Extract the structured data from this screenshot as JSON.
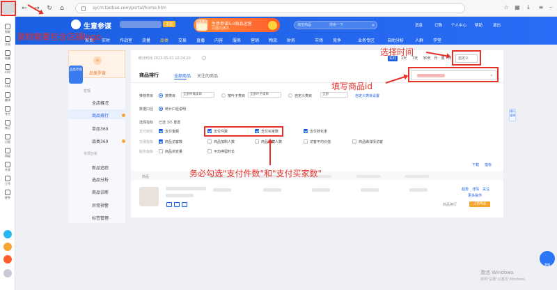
{
  "browser": {
    "url": "sycm.taobao.com/portal/home.htm",
    "nav_back": "←",
    "nav_forward": "→",
    "nav_reload": "↻",
    "nav_home": "⌂"
  },
  "sidebar": {
    "items": [
      "智能",
      "文档",
      "收藏",
      "AI写",
      "AI读",
      "翻译",
      "专栏",
      "笔记",
      "日程",
      "网盘",
      "共享",
      "工作",
      "更多"
    ]
  },
  "header": {
    "title": "生意参谋",
    "badge": "主店",
    "promo_tag": "抢先看",
    "promo_title": "生意参谋5.0商品运营",
    "promo_sub": "兴趣内测中",
    "search_label": "淘宝商品",
    "search_placeholder": "搜索一下",
    "right_links": [
      "消息",
      "订购",
      "个人中心",
      "帮助",
      "退出"
    ],
    "nav": [
      "首页",
      "实时",
      "作战室",
      "流量",
      "品类",
      "交易",
      "直播",
      "内容",
      "服务",
      "营销",
      "物流",
      "财务",
      "市场",
      "竞争",
      "业务专区",
      "自助分析",
      "人群",
      "学堂"
    ],
    "nav_active_index": 4
  },
  "left_menu": {
    "top_label": "品类罗盘",
    "float_label": "品类罗盘",
    "group1": "宏观",
    "group2": "商品",
    "group3": "专项分析",
    "items": [
      "全店概况",
      "商品排行",
      "单品360",
      "品类360",
      "新品追踪",
      "选品分析",
      "商品诊断",
      "异常预警",
      "标签管理"
    ],
    "active_index": 1
  },
  "toolbar": {
    "stats_time": "统计时间 2023-05-01 10:24:20",
    "segments": [
      "实时",
      "1天",
      "7天",
      "30天",
      "日",
      "周",
      "月"
    ],
    "date_picker": "自定义"
  },
  "card": {
    "title": "商品排行",
    "tab_all": "全部商品",
    "tab_fav": "关注的商品",
    "search_icon": "⌕"
  },
  "filters": {
    "row1_label": "推荐类目",
    "row1_opt1": "按类目",
    "row1_sel1": "全部终端类目",
    "row1_opt2": "按叶子类目",
    "row1_sel2": "全部叶子类目",
    "row1_opt3": "自定义类目",
    "row1_sel3": "全部",
    "row1_link": "自定义类目设置",
    "row2_label": "数据口径",
    "row2_opt": "统计口径说明",
    "row3_label": "选择指标",
    "row3_count": "已选 3/5 重置",
    "metric_groups": [
      "支付转化",
      "交易指标",
      "服务指标",
      "流量指标"
    ],
    "metrics": [
      {
        "label": "支付金额",
        "checked": true
      },
      {
        "label": "支付件数",
        "checked": true
      },
      {
        "label": "支付买家数",
        "checked": true
      },
      {
        "label": "支付转化率",
        "checked": true
      },
      {
        "label": "商品访客数",
        "checked": true
      },
      {
        "label": "商品加购人数",
        "checked": false
      },
      {
        "label": "商品收藏人数",
        "checked": false
      },
      {
        "label": "访客平均价值",
        "checked": false
      },
      {
        "label": "商品浏览量",
        "checked": false
      },
      {
        "label": "商品微详情访客",
        "checked": false
      },
      {
        "label": "平均停留时长",
        "checked": false
      }
    ]
  },
  "table": {
    "head_first": "商品",
    "right_links": [
      "下载",
      "指标"
    ],
    "row_actions": [
      "趋势",
      "详情",
      "关注"
    ],
    "row_action2": "更多操作",
    "row_tag": "商品排行",
    "row_button": "上新商品"
  },
  "misc": {
    "side_tag": "排行说明",
    "chat": "客服",
    "win_activate": "激活 Windows",
    "win_hint": "转到\"设置\"以激活 Windows。"
  },
  "annotations": {
    "logo": "录制需要包含店铺logo",
    "time": "选择时间",
    "product_id": "填写商品id",
    "metrics": "务必勾选\"支付件数\"和\"支付买家数\"",
    "color": "#e8302a"
  }
}
